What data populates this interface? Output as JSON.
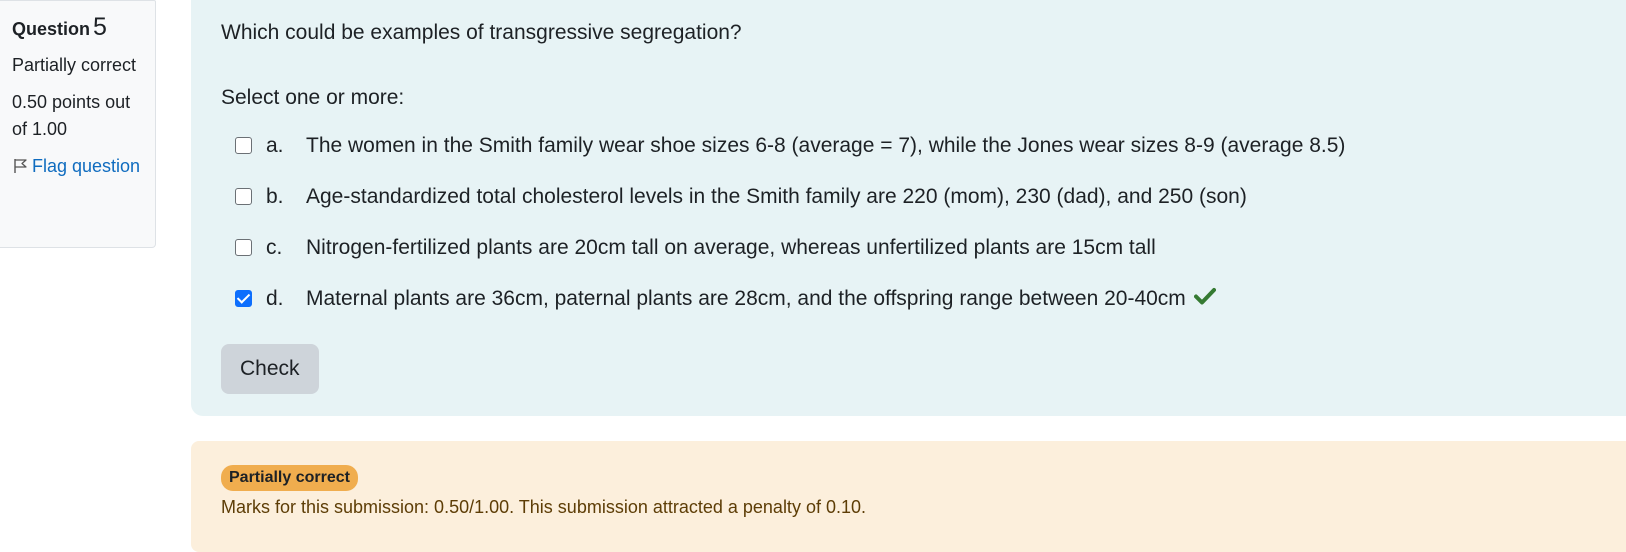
{
  "info": {
    "question_label": "Question",
    "question_number": "5",
    "state": "Partially correct",
    "grade": "0.50 points out of 1.00",
    "flag_label": "Flag question"
  },
  "question": {
    "text": "Which could be examples of transgressive segregation?",
    "prompt": "Select one or more:",
    "options": [
      {
        "letter": "a.",
        "text": "The women in the Smith family wear shoe sizes 6-8 (average = 7), while the Jones wear sizes 8-9 (average 8.5)",
        "checked": false
      },
      {
        "letter": "b.",
        "text": "Age-standardized total cholesterol levels in the Smith family are 220 (mom), 230 (dad), and 250 (son)",
        "checked": false
      },
      {
        "letter": "c.",
        "text": "Nitrogen-fertilized plants are 20cm tall on average, whereas unfertilized plants are 15cm tall",
        "checked": false
      },
      {
        "letter": "d.",
        "text": "Maternal plants are 36cm, paternal plants are 28cm, and the offspring range between 20-40cm",
        "checked": true,
        "correct_mark": true
      }
    ],
    "check_button": "Check"
  },
  "feedback": {
    "badge": "Partially correct",
    "marks": "Marks for this submission: 0.50/1.00. This submission attracted a penalty of 0.10."
  },
  "colors": {
    "formulation_bg": "#e7f3f5",
    "feedback_bg": "#fcefdc",
    "badge_bg": "#f0ad4e",
    "link": "#0f6cbf",
    "correct_tick": "#357a32",
    "checkbox_checked": "#0d6efd"
  }
}
